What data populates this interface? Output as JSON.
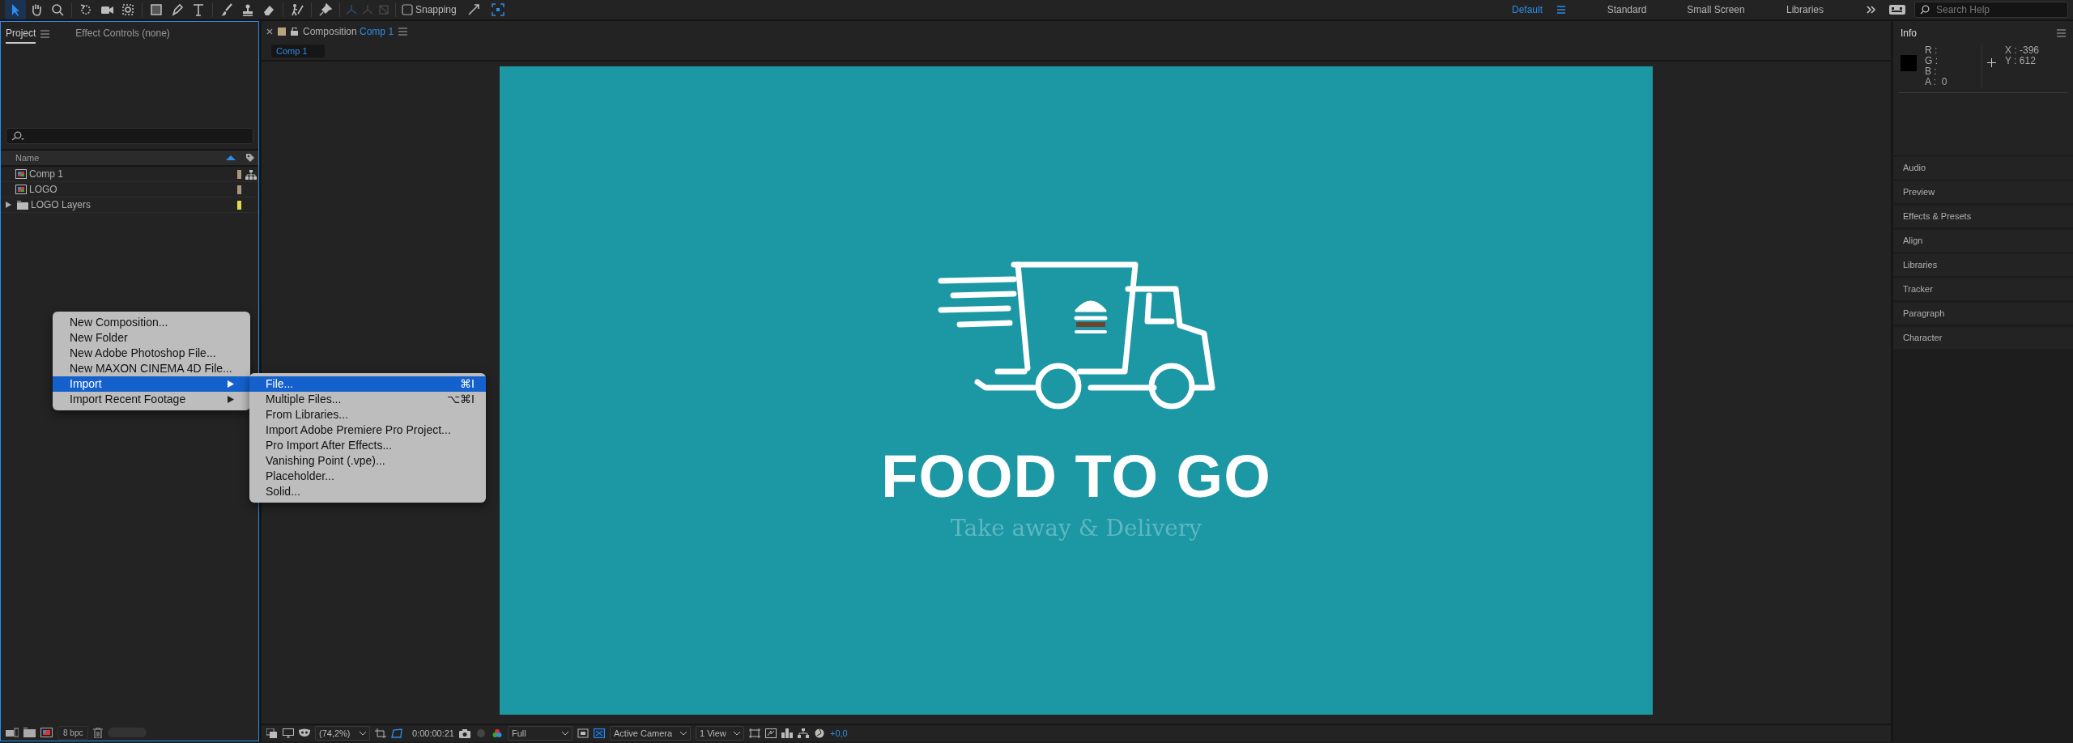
{
  "toolbar": {
    "tools": [
      {
        "kind": "select",
        "selected": true
      },
      {
        "kind": "hand",
        "selected": false
      },
      {
        "kind": "zoom",
        "selected": false
      },
      {
        "kind": "rotate",
        "selected": false
      },
      {
        "kind": "camera",
        "selected": false
      },
      {
        "kind": "pan",
        "selected": false
      },
      {
        "kind": "rectangle",
        "selected": false
      },
      {
        "kind": "pen",
        "selected": false
      },
      {
        "kind": "text",
        "selected": false
      },
      {
        "kind": "brush",
        "selected": false
      },
      {
        "kind": "stamp",
        "selected": false
      },
      {
        "kind": "eraser",
        "selected": false
      },
      {
        "kind": "roto",
        "selected": false
      },
      {
        "kind": "pin",
        "selected": false
      }
    ],
    "snapping": {
      "label": "Snapping",
      "checked": false
    },
    "workspaces": [
      {
        "label": "Default",
        "selected": true
      },
      {
        "label": "Standard",
        "selected": false
      },
      {
        "label": "Small Screen",
        "selected": false
      },
      {
        "label": "Libraries",
        "selected": false
      }
    ],
    "search": {
      "placeholder": "Search Help"
    }
  },
  "project_panel": {
    "tabs": [
      {
        "label": "Project",
        "selected": true
      },
      {
        "label": "Effect Controls (none)",
        "selected": false
      }
    ],
    "column": "Name",
    "items": [
      {
        "name": "Comp 1",
        "kind": "comp",
        "color": "#a8977a"
      },
      {
        "name": "LOGO",
        "kind": "comp",
        "color": "#a8977a"
      },
      {
        "name": "LOGO Layers",
        "kind": "folder",
        "color": "#e2d84a",
        "expanded": false
      }
    ],
    "bpc": "8 bpc"
  },
  "context_menu": {
    "items": [
      {
        "label": "New Composition...",
        "submenu": false,
        "selected": false
      },
      {
        "label": "New Folder",
        "submenu": false,
        "selected": false
      },
      {
        "label": "New Adobe Photoshop File...",
        "submenu": false,
        "selected": false
      },
      {
        "label": "New MAXON CINEMA 4D File...",
        "submenu": false,
        "selected": false
      },
      {
        "label": "Import",
        "submenu": true,
        "selected": true
      },
      {
        "label": "Import Recent Footage",
        "submenu": true,
        "selected": false
      }
    ],
    "submenu": [
      {
        "label": "File...",
        "shortcut": "⌘I",
        "selected": true
      },
      {
        "label": "Multiple Files...",
        "shortcut": "⌥⌘I",
        "selected": false
      },
      {
        "label": "From Libraries...",
        "selected": false
      },
      {
        "label": "Import Adobe Premiere Pro Project...",
        "selected": false
      },
      {
        "label": "Pro Import After Effects...",
        "selected": false
      },
      {
        "label": "Vanishing Point (.vpe)...",
        "selected": false
      },
      {
        "label": "Placeholder...",
        "selected": false
      },
      {
        "label": "Solid...",
        "selected": false
      }
    ]
  },
  "composition": {
    "tab_label": "Composition",
    "name": "Comp 1",
    "viewer_tab": "Comp 1",
    "artwork": {
      "title": "FOOD TO GO",
      "tagline": "Take away & Delivery"
    },
    "footer": {
      "zoom": "(74,2%)",
      "timecode": "0:00:00:21",
      "resolution": "Full",
      "camera": "Active Camera",
      "views": "1 View",
      "exposure": "+0,0"
    }
  },
  "info_panel": {
    "title": "Info",
    "channels": [
      {
        "label": "R :"
      },
      {
        "label": "G :"
      },
      {
        "label": "B :"
      },
      {
        "label": "A :",
        "value": "0"
      }
    ],
    "coords": [
      {
        "label": "X :",
        "value": "-396"
      },
      {
        "label": "Y :",
        "value": "612"
      }
    ]
  },
  "panels": [
    "Audio",
    "Preview",
    "Effects & Presets",
    "Align",
    "Libraries",
    "Tracker",
    "Paragraph",
    "Character"
  ]
}
